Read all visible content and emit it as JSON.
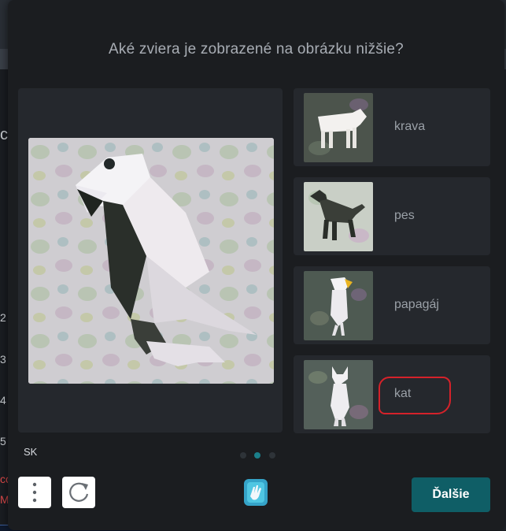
{
  "background": {
    "fragments": [
      {
        "text": "ce",
        "color": "#cfd3d8"
      },
      {
        "text": "2",
        "color": "#cfd3d8"
      },
      {
        "text": "3",
        "color": "#cfd3d8"
      },
      {
        "text": "4",
        "color": "#cfd3d8"
      },
      {
        "text": "5",
        "color": "#cfd3d8"
      },
      {
        "text": "cc",
        "color": "#e24b4b"
      },
      {
        "text": "M",
        "color": "#e24b4b"
      }
    ]
  },
  "captcha": {
    "question": "Aké zviera je zobrazené na obrázku nižšie?",
    "main_image_icon": "parrot-image",
    "options": [
      {
        "label": "krava",
        "icon": "cow-image"
      },
      {
        "label": "pes",
        "icon": "dog-image"
      },
      {
        "label": "papagáj",
        "icon": "parrot-image"
      },
      {
        "label": "kat",
        "icon": "cat-image",
        "annotated": true
      }
    ],
    "language": "SK",
    "pagination": {
      "total": 3,
      "active": 2
    },
    "next_label": "Ďalšie",
    "colors": {
      "accent": "#0f5e66",
      "annotation": "#d5222a",
      "dot_active": "#1b7f8a"
    }
  }
}
